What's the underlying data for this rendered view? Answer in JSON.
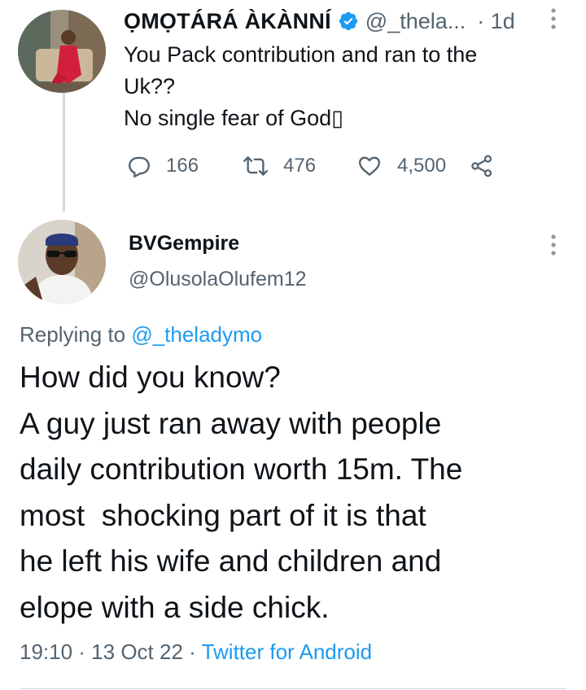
{
  "parent_tweet": {
    "display_name": "ỌMỌTÁRÁ ÀKÀNNÍ",
    "handle": "@_thela...",
    "time": "· 1d",
    "text_lines": [
      "You Pack contribution and ran to the",
      "Uk??",
      "No single fear of God▯"
    ],
    "metrics": {
      "replies": "166",
      "retweets": "476",
      "likes": "4,500"
    }
  },
  "reply_tweet": {
    "display_name": "BVGempire",
    "handle": "@OlusolaOlufem12",
    "replying_prefix": "Replying to",
    "replying_to": "@_theladymo",
    "text_lines": [
      "How did you know?",
      "A guy just ran away with people",
      "daily contribution worth 15m. The",
      "most  shocking part of it is that",
      "he left his wife and children and",
      "elope with a side chick."
    ],
    "timestamp": "19:10 · 13 Oct 22 ·",
    "source": "Twitter for Android"
  },
  "colors": {
    "accent": "#1d9bf0",
    "secondary_text": "#536471",
    "primary_text": "#0f1419",
    "divider": "#cfd9de"
  },
  "icons": {
    "verified": "verified-badge-icon",
    "reply": "speech-bubble-icon",
    "retweet": "retweet-arrows-icon",
    "like": "heart-icon",
    "share": "share-nodes-icon",
    "more": "vertical-ellipsis-icon"
  }
}
